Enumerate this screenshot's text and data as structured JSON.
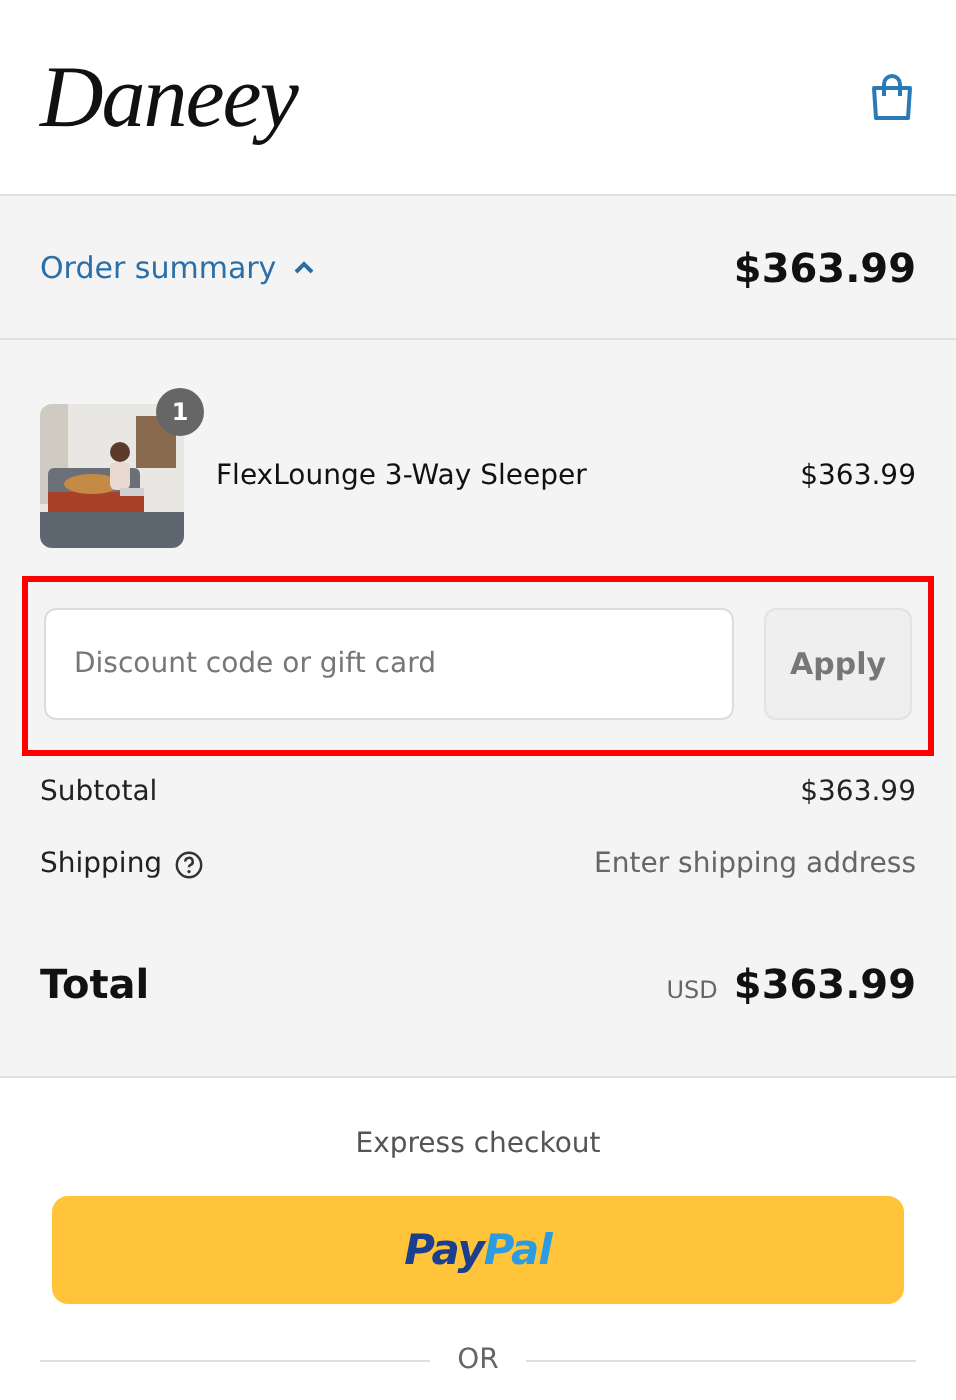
{
  "header": {
    "logo": "Daneey"
  },
  "summary_bar": {
    "label": "Order summary",
    "expanded": true,
    "total": "$363.99"
  },
  "items": [
    {
      "kind": "picture",
      "name": "FlexLounge 3-Way Sleeper",
      "quantity": "1",
      "price": "$363.99"
    }
  ],
  "discount": {
    "placeholder": "Discount code or gift card",
    "button": "Apply",
    "disabled": true,
    "highlighted": true
  },
  "totals": [
    {
      "kind": "line",
      "label": "Subtotal",
      "value": "$363.99"
    },
    {
      "kind": "help",
      "label": "Shipping",
      "value": "Enter shipping address"
    },
    {
      "kind": "total",
      "label": "Total",
      "currency": "USD",
      "value": "$363.99"
    }
  ],
  "express": {
    "heading": "Express checkout",
    "logo_parts": [
      {
        "text": "Pay",
        "color": "#1b3f8f"
      },
      {
        "text": "Pal",
        "color": "#2c9be0"
      }
    ],
    "divider": "OR"
  }
}
